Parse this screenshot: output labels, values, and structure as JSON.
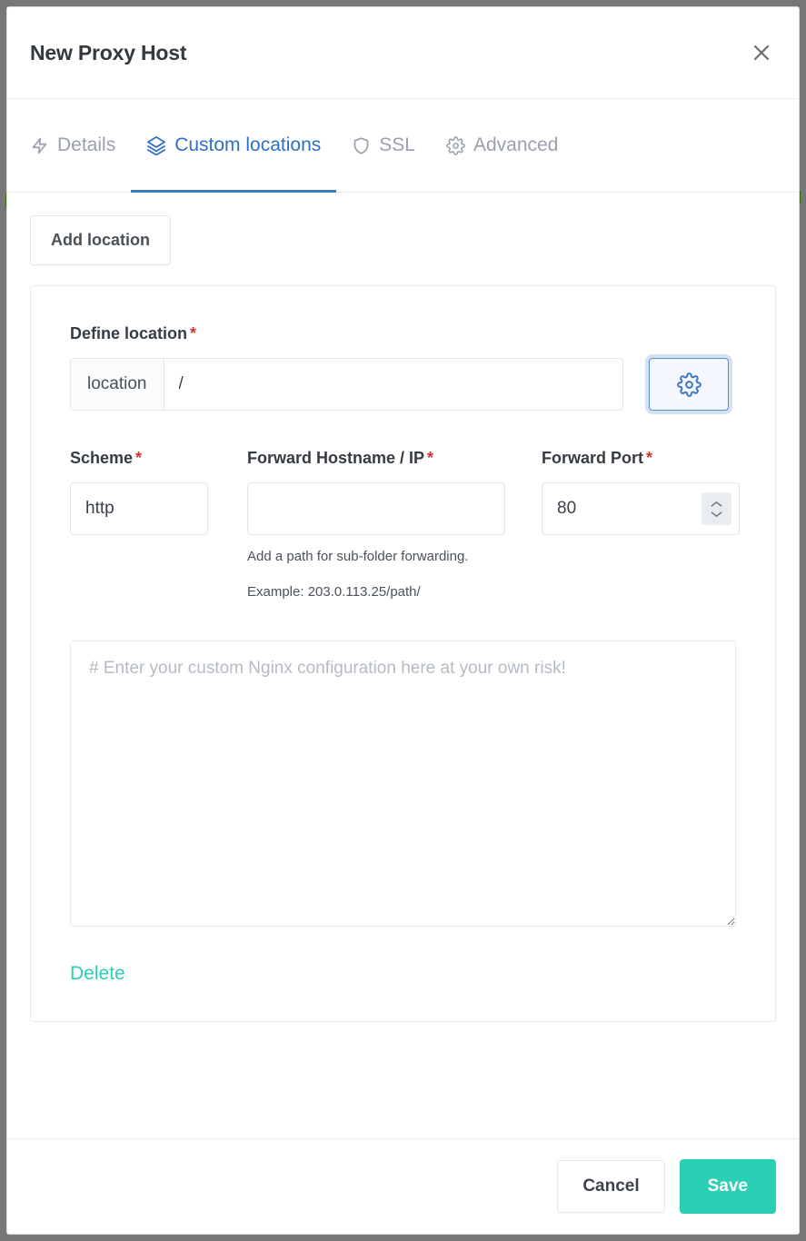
{
  "modal": {
    "title": "New Proxy Host",
    "close_icon": "close-icon"
  },
  "tabs": [
    {
      "label": "Details",
      "icon": "lightning-bolt-icon",
      "active": false
    },
    {
      "label": "Custom locations",
      "icon": "layers-icon",
      "active": true
    },
    {
      "label": "SSL",
      "icon": "shield-icon",
      "active": false
    },
    {
      "label": "Advanced",
      "icon": "gear-icon",
      "active": false
    }
  ],
  "toolbar": {
    "add_location_label": "Add location"
  },
  "location_card": {
    "define_location_label": "Define location",
    "required_marker": "*",
    "location_prefix": "location",
    "location_value": "/",
    "location_placeholder": "",
    "settings_button_icon": "gear-icon",
    "scheme_label": "Scheme",
    "scheme_value": "http",
    "forward_host_label": "Forward Hostname / IP",
    "forward_host_value": "",
    "forward_host_placeholder": "",
    "forward_port_label": "Forward Port",
    "forward_port_value": "80",
    "help_line_1": "Add a path for sub-folder forwarding.",
    "help_line_2": "Example: 203.0.113.25/path/",
    "nginx_placeholder": "# Enter your custom Nginx configuration here at your own risk!",
    "nginx_value": "",
    "delete_label": "Delete"
  },
  "footer": {
    "cancel_label": "Cancel",
    "save_label": "Save"
  },
  "background": {
    "text_left": "",
    "text_right": ""
  },
  "colors": {
    "accent_blue": "#2e6fc7",
    "accent_teal": "#2bcfb4",
    "required_red": "#cd3232",
    "muted_gray": "#9aa0ac"
  }
}
